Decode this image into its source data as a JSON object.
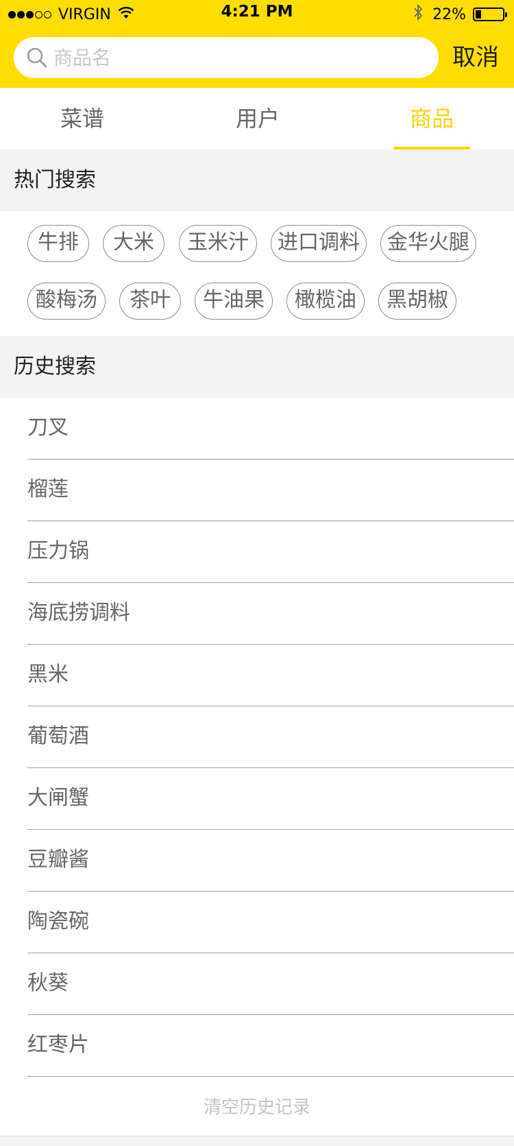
{
  "status_bar": {
    "carrier": "VIRGIN",
    "time": "4:21 PM",
    "battery": "22%",
    "battery_level": 0.22,
    "signal_bars_filled": 3,
    "signal_bars_total": 5
  },
  "search": {
    "placeholder": "商品名",
    "value": "",
    "cancel_label": "取消"
  },
  "tabs": [
    {
      "label": "菜谱",
      "active": false
    },
    {
      "label": "用户",
      "active": false
    },
    {
      "label": "商品",
      "active": true
    }
  ],
  "hot_search": {
    "title": "热门搜索",
    "tags": [
      "牛排",
      "大米",
      "玉米汁",
      "进口调料",
      "金华火腿",
      "酸梅汤",
      "茶叶",
      "牛油果",
      "橄榄油",
      "黑胡椒"
    ]
  },
  "history_search": {
    "title": "历史搜索",
    "items": [
      "刀叉",
      "榴莲",
      "压力锅",
      "海底捞调料",
      "黑米",
      "葡萄酒",
      "大闸蟹",
      "豆瓣酱",
      "陶瓷碗",
      "秋葵",
      "红枣片"
    ],
    "clear_label": "清空历史记录"
  },
  "colors": {
    "accent": "#FFDD00",
    "active_tab": "#FFD200",
    "section_bg": "#F3F3F3",
    "placeholder": "#C8C8C8"
  },
  "icons": {
    "search": "search-icon",
    "wifi": "wifi-icon",
    "bluetooth": "bluetooth-icon",
    "battery": "battery-icon"
  }
}
